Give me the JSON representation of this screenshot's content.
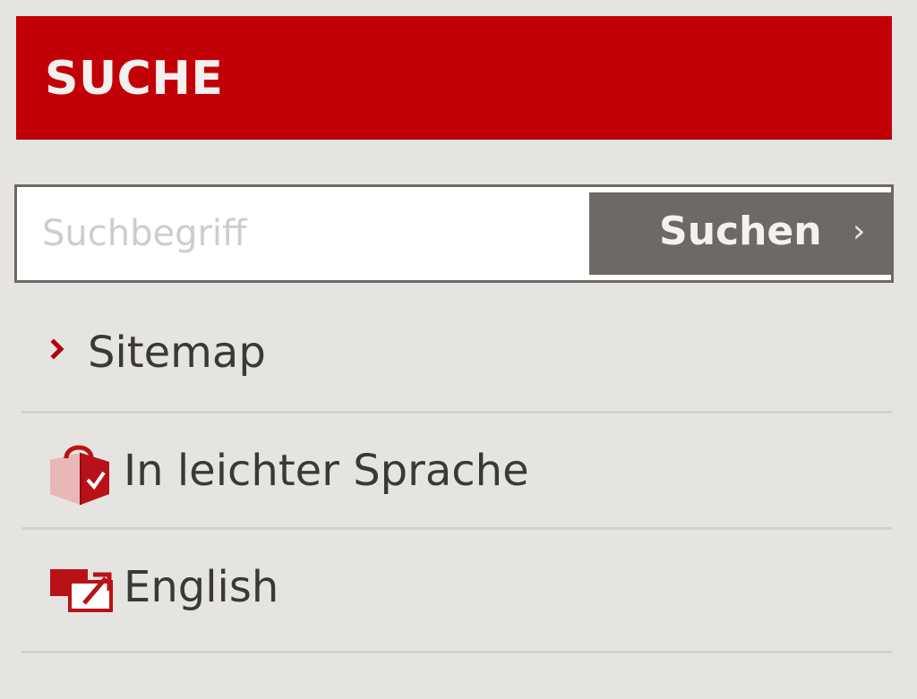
{
  "header": {
    "title": "SUCHE"
  },
  "search": {
    "placeholder": "Suchbegriff",
    "value": "",
    "button_label": "Suchen",
    "button_chevron": "›"
  },
  "links": {
    "sitemap": {
      "label": "Sitemap",
      "icon": "chevron-right-icon"
    },
    "easy_language": {
      "label": "In leichter Sprache",
      "icon": "easy-language-icon"
    },
    "english": {
      "label": "English",
      "icon": "language-switch-icon"
    }
  },
  "colors": {
    "brand_red": "#c10008",
    "button_gray": "#6f6965",
    "background": "#e6e4e1",
    "text": "#3b3936"
  }
}
